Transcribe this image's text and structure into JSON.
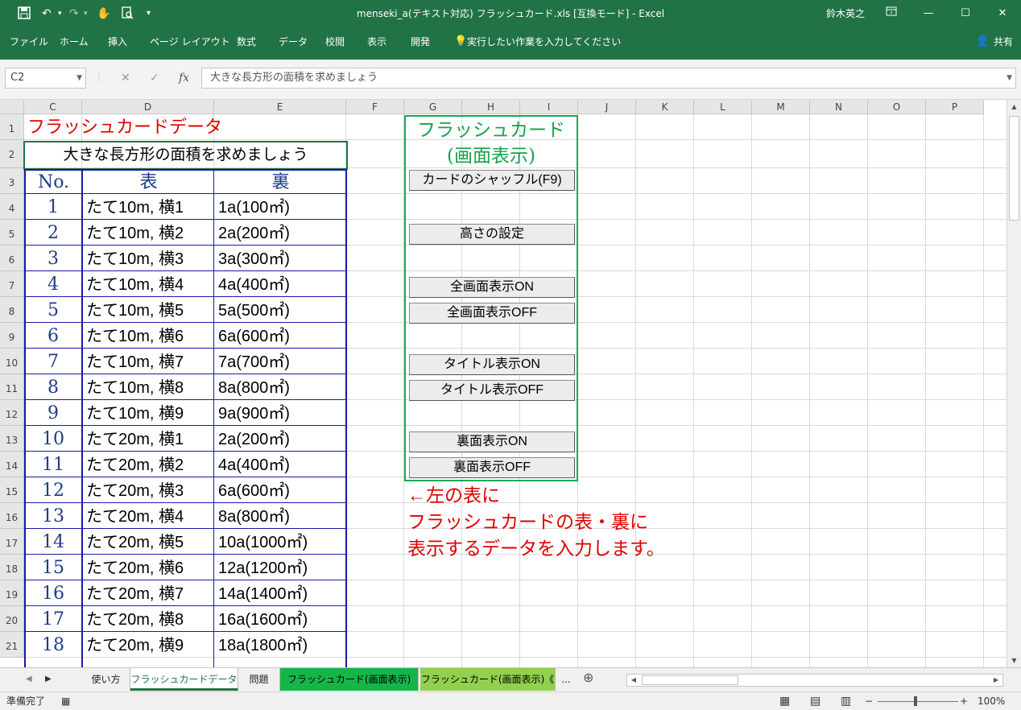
{
  "window": {
    "title": "menseki_a(テキスト対応) フラッシュカード.xls [互換モード] - Excel",
    "user": "鈴木英之",
    "qa_icons": [
      "save-icon",
      "undo-icon",
      "redo-icon",
      "touch-mode-icon",
      "print-preview-icon",
      "customize-icon"
    ]
  },
  "ribbon": {
    "tabs": [
      "ファイル",
      "ホーム",
      "挿入",
      "ページ レイアウト",
      "数式",
      "データ",
      "校閲",
      "表示",
      "開発"
    ],
    "tell_me": "実行したい作業を入力してください",
    "share": "共有"
  },
  "formula_bar": {
    "name_box": "C2",
    "formula": "大きな長方形の面積を求めましょう"
  },
  "columns": [
    "C",
    "D",
    "E",
    "F",
    "G",
    "H",
    "I",
    "J",
    "K",
    "L",
    "M",
    "N",
    "O",
    "P"
  ],
  "rows": [
    "1",
    "2",
    "3",
    "4",
    "5",
    "6",
    "7",
    "8",
    "9",
    "10",
    "11",
    "12",
    "13",
    "14",
    "15",
    "16",
    "17",
    "18",
    "19",
    "20",
    "21"
  ],
  "sheet": {
    "title": "フラッシュカードデータ",
    "subject": "大きな長方形の面積を求めましょう",
    "headers": {
      "no": "No.",
      "front": "表",
      "back": "裏"
    },
    "cards": [
      {
        "no": "1",
        "front": "たて10m, 横1",
        "back": "1a(100㎡)"
      },
      {
        "no": "2",
        "front": "たて10m, 横2",
        "back": "2a(200㎡)"
      },
      {
        "no": "3",
        "front": "たて10m, 横3",
        "back": "3a(300㎡)"
      },
      {
        "no": "4",
        "front": "たて10m, 横4",
        "back": "4a(400㎡)"
      },
      {
        "no": "5",
        "front": "たて10m, 横5",
        "back": "5a(500㎡)"
      },
      {
        "no": "6",
        "front": "たて10m, 横6",
        "back": "6a(600㎡)"
      },
      {
        "no": "7",
        "front": "たて10m, 横7",
        "back": "7a(700㎡)"
      },
      {
        "no": "8",
        "front": "たて10m, 横8",
        "back": "8a(800㎡)"
      },
      {
        "no": "9",
        "front": "たて10m, 横9",
        "back": "9a(900㎡)"
      },
      {
        "no": "10",
        "front": "たて20m, 横1",
        "back": "2a(200㎡)"
      },
      {
        "no": "11",
        "front": "たて20m, 横2",
        "back": "4a(400㎡)"
      },
      {
        "no": "12",
        "front": "たて20m, 横3",
        "back": "6a(600㎡)"
      },
      {
        "no": "13",
        "front": "たて20m, 横4",
        "back": "8a(800㎡)"
      },
      {
        "no": "14",
        "front": "たて20m, 横5",
        "back": "10a(1000㎡)"
      },
      {
        "no": "15",
        "front": "たて20m, 横6",
        "back": "12a(1200㎡)"
      },
      {
        "no": "16",
        "front": "たて20m, 横7",
        "back": "14a(1400㎡)"
      },
      {
        "no": "17",
        "front": "たて20m, 横8",
        "back": "16a(1600㎡)"
      },
      {
        "no": "18",
        "front": "たて20m, 横9",
        "back": "18a(1800㎡)"
      }
    ]
  },
  "panel": {
    "title_line1": "フラッシュカード",
    "title_line2": "(画面表示)",
    "buttons": [
      "カードのシャッフル(F9)",
      "高さの設定",
      "全画面表示ON",
      "全画面表示OFF",
      "タイトル表示ON",
      "タイトル表示OFF",
      "裏面表示ON",
      "裏面表示OFF"
    ]
  },
  "note": {
    "line1": "←左の表に",
    "line2": "フラッシュカードの表・裏に",
    "line3": "表示するデータを入力します。"
  },
  "sheet_tabs": [
    "使い方",
    "フラッシュカードデータ",
    "問題",
    "フラッシュカード(画面表示)",
    "フラッシュカード(画面表示)《",
    "..."
  ],
  "status": {
    "ready": "準備完了",
    "zoom": "100%"
  },
  "colors": {
    "excel_green": "#217346",
    "heading_red": "#e00000",
    "table_blue": "#1a1aa6",
    "panel_green": "#1aaa55"
  }
}
